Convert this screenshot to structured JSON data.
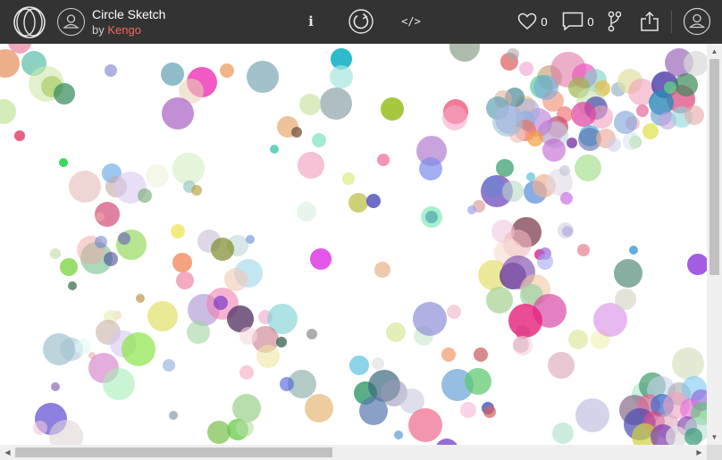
{
  "header": {
    "title": "Circle Sketch",
    "by_prefix": "by",
    "author": "Kengo",
    "info_label": "i",
    "code_label": "</>",
    "likes_count": "0",
    "comments_count": "0"
  },
  "colors": {
    "topbar": "#333333",
    "author_link": "#f26a5b",
    "canvas_bg": "#ffffff"
  },
  "icons": [
    "logo-icon",
    "author-avatar-icon",
    "info-icon",
    "restart-icon",
    "code-icon",
    "heart-icon",
    "comment-icon",
    "fork-icon",
    "share-icon",
    "account-icon"
  ],
  "scrollbars": {
    "vertical_position": 0,
    "horizontal_position": 0
  }
}
